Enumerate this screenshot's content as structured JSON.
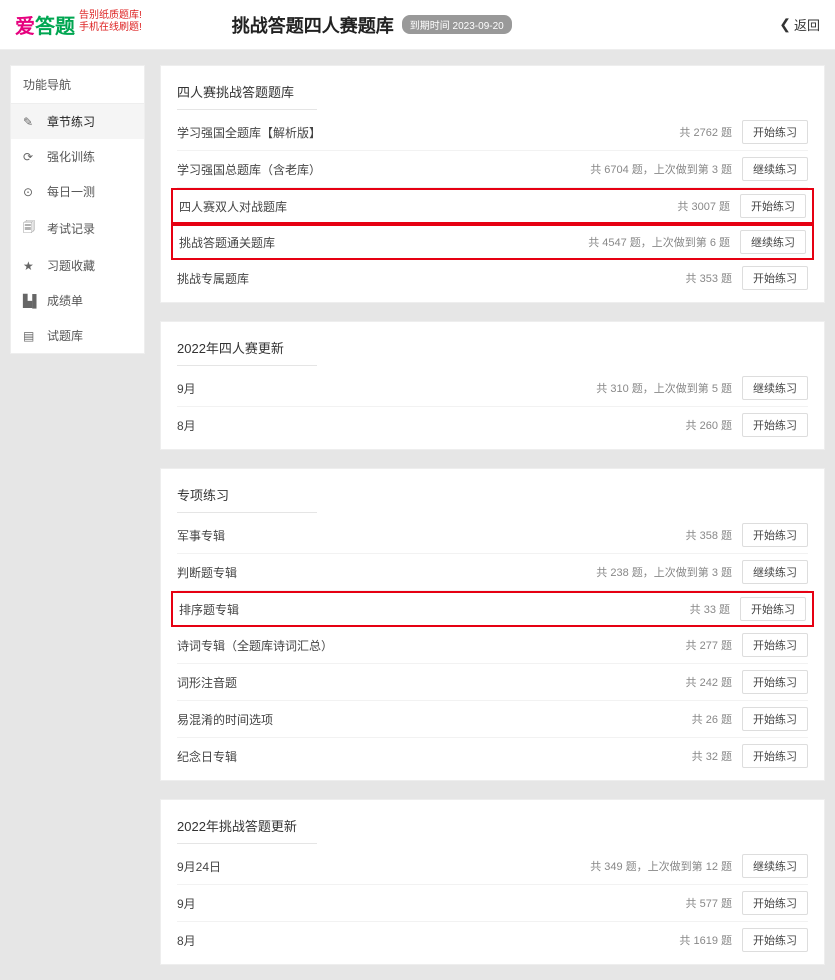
{
  "header": {
    "logo_main": "爱答题",
    "logo_tagline1": "告别纸质题库!",
    "logo_tagline2": "手机在线刷题!",
    "title": "挑战答题四人赛题库",
    "expiry": "到期时间 2023-09-20",
    "back": "返回"
  },
  "sidebar": {
    "title": "功能导航",
    "items": [
      {
        "icon": "✎",
        "label": "章节练习",
        "icon_name": "pencil-icon",
        "active": true
      },
      {
        "icon": "⟳",
        "label": "强化训练",
        "icon_name": "refresh-icon"
      },
      {
        "icon": "⊙",
        "label": "每日一测",
        "icon_name": "target-icon"
      },
      {
        "icon": "🗐",
        "label": "考试记录",
        "icon_name": "document-icon"
      },
      {
        "icon": "★",
        "label": "习题收藏",
        "icon_name": "star-icon"
      },
      {
        "icon": "▙▌",
        "label": "成绩单",
        "icon_name": "chart-icon"
      },
      {
        "icon": "▤",
        "label": "试题库",
        "icon_name": "list-icon"
      }
    ]
  },
  "sections": [
    {
      "title": "四人赛挑战答题题库",
      "rows": [
        {
          "title": "学习强国全题库【解析版】",
          "meta": "共 2762 题",
          "btn": "开始练习"
        },
        {
          "title": "学习强国总题库（含老库）",
          "meta": "共 6704 题，上次做到第 3 题",
          "btn": "继续练习"
        },
        {
          "title": "四人赛双人对战题库",
          "meta": "共 3007 题",
          "btn": "开始练习",
          "hl": true
        },
        {
          "title": "挑战答题通关题库",
          "meta": "共 4547 题，上次做到第 6 题",
          "btn": "继续练习",
          "hl": true
        },
        {
          "title": "挑战专属题库",
          "meta": "共 353 题",
          "btn": "开始练习"
        }
      ]
    },
    {
      "title": "2022年四人赛更新",
      "rows": [
        {
          "title": "9月",
          "meta": "共 310 题，上次做到第 5 题",
          "btn": "继续练习"
        },
        {
          "title": "8月",
          "meta": "共 260 题",
          "btn": "开始练习"
        }
      ]
    },
    {
      "title": "专项练习",
      "rows": [
        {
          "title": "军事专辑",
          "meta": "共 358 题",
          "btn": "开始练习"
        },
        {
          "title": "判断题专辑",
          "meta": "共 238 题，上次做到第 3 题",
          "btn": "继续练习"
        },
        {
          "title": "排序题专辑",
          "meta": "共 33 题",
          "btn": "开始练习",
          "hl": true
        },
        {
          "title": "诗词专辑（全题库诗词汇总）",
          "meta": "共 277 题",
          "btn": "开始练习"
        },
        {
          "title": "词形注音题",
          "meta": "共 242 题",
          "btn": "开始练习"
        },
        {
          "title": "易混淆的时间选项",
          "meta": "共 26 题",
          "btn": "开始练习"
        },
        {
          "title": "纪念日专辑",
          "meta": "共 32 题",
          "btn": "开始练习"
        }
      ]
    },
    {
      "title": "2022年挑战答题更新",
      "rows": [
        {
          "title": "9月24日",
          "meta": "共 349 题，上次做到第 12 题",
          "btn": "继续练习"
        },
        {
          "title": "9月",
          "meta": "共 577 题",
          "btn": "开始练习"
        },
        {
          "title": "8月",
          "meta": "共 1619 题",
          "btn": "开始练习"
        }
      ]
    }
  ]
}
